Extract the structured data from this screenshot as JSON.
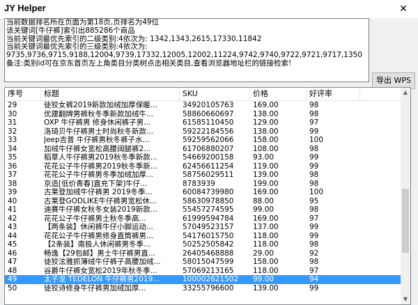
{
  "window": {
    "title": "JY Helper",
    "close_glyph": "✕"
  },
  "info": {
    "lines": [
      "当前数据排名所在页面为第18页,页排名为49位",
      "该关键词[牛仔裤]索引出885286个商品",
      "当前关键词最优先索引的二级类别:4依次为: 1342,1343,2615,17330,11842",
      "当前关键词最优先索引的三级类别:4依次为:",
      "9735,9736,9715,9188,12004,9739,17332,12005,12002,11224,9742,9740,9722,9721,9717,1350",
      "备注:类别id可在京东首页左上角类目分类树点击相关类目,查看浏览器地址栏的链接检索!"
    ]
  },
  "export_button": {
    "label": "导出 WPS"
  },
  "table": {
    "columns": [
      "序号",
      "标题",
      "SKU",
      "价格",
      "好评率"
    ],
    "selected_index": 20,
    "rows": [
      [
        "29",
        "徒狡女裤2019新款加绒加厚保暖...",
        "34920105763",
        "169.00",
        "98"
      ],
      [
        "30",
        "优建翻牌男裤秋冬季新款加绒牛...",
        "58860660697",
        "138.00",
        "98"
      ],
      [
        "31",
        "OXP 牛仔裤男 修身休闲裤子男...",
        "61585110450",
        "129.00",
        "97"
      ],
      [
        "32",
        "洛琦贝牛仔裤男士时尚秋冬新款...",
        "59222184556",
        "138.00",
        "99"
      ],
      [
        "33",
        "Jeep吉普 牛仔裤男秋冬裤子水...",
        "59259562066",
        "158.00",
        "100"
      ],
      [
        "34",
        "加绒牛仔裤女宽松高腰阔腿裤2...",
        "61706880207",
        "108.00",
        "98"
      ],
      [
        "35",
        "稻草人牛仔裤男2019秋冬季新款...",
        "54669200158",
        "93.00",
        "99"
      ],
      [
        "36",
        "花花公子牛仔裤男2019秋冬季新...",
        "62456611254",
        "119.00",
        "99"
      ],
      [
        "37",
        "花花公子牛仔裤男冬季加绒加厚...",
        "58756029511",
        "139.00",
        "98"
      ],
      [
        "38",
        "京造[低价青春]直充下架]牛仔...",
        "8783939",
        "199.00",
        "98"
      ],
      [
        "39",
        "古莱登加绒牛仔裤男 2019冬季...",
        "60084739980",
        "169.00",
        "100"
      ],
      [
        "40",
        "古莱登GODLIKE牛仔裤男宽松休...",
        "58630978850",
        "88.00",
        "95"
      ],
      [
        "41",
        "迪赛牛仔裤女秋冬女装2019新款...",
        "55457274595",
        "99.00",
        "98"
      ],
      [
        "42",
        "花花公子牛仔裤男士秋冬季高...",
        "61999594784",
        "169.00",
        "97"
      ],
      [
        "43",
        "【两条装】休闲裤牛仔小脚运动...",
        "57049523157",
        "137.00",
        "99"
      ],
      [
        "44",
        "花花公子牛仔裤男修身直筒裤男...",
        "54176015750",
        "118.00",
        "99"
      ],
      [
        "45",
        "【2条装】南极人休闲裤男冬季...",
        "50252505842",
        "118.00",
        "98"
      ],
      [
        "46",
        "畅逸【29包邮】男士牛仔裤男直...",
        "26405468888",
        "29.00",
        "92"
      ],
      [
        "47",
        "徒狡泫雅抓薄绒牛仔裤子高腰加绒...",
        "58015047599",
        "158.00",
        "98"
      ],
      [
        "48",
        "谷爵牛仔裤女宽松2019年秋冬季...",
        "57069213165",
        "118.00",
        "97"
      ],
      [
        "49",
        "太子龙 TEDELON 牛仔裤男2019...",
        "100002621502",
        "99.00",
        "94"
      ],
      [
        "50",
        "徒狡诗修身牛仔裤男加绒加厚...",
        "33255796600",
        "139.00",
        "99"
      ]
    ]
  },
  "icons": {
    "scroll_up": "▲",
    "scroll_down": "▼"
  }
}
